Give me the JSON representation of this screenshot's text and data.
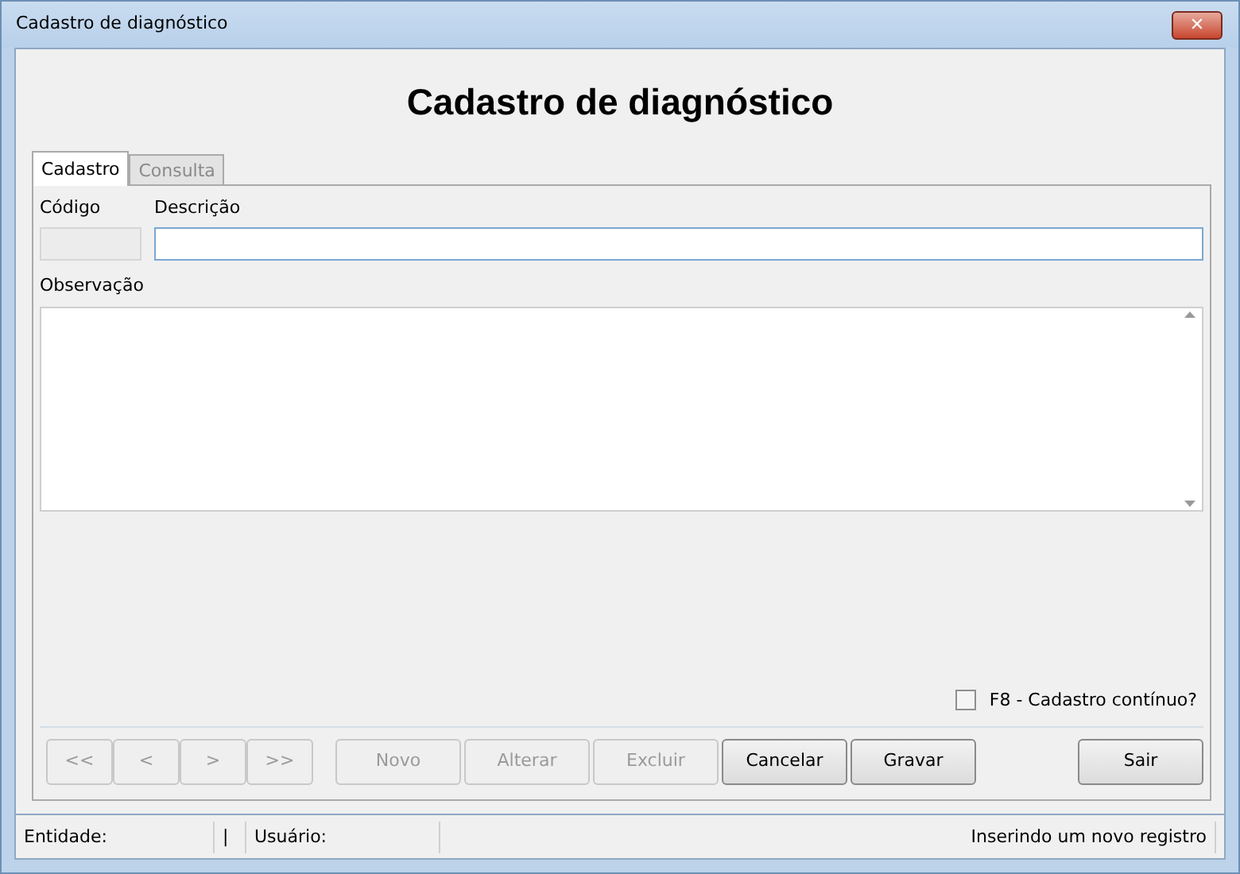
{
  "window": {
    "title": "Cadastro de diagnóstico",
    "close": "✕"
  },
  "heading": "Cadastro de diagnóstico",
  "tabs": [
    {
      "label": "Cadastro",
      "selected": true
    },
    {
      "label": "Consulta",
      "selected": false
    }
  ],
  "fields": {
    "codigo": {
      "label": "Código",
      "disabled": true
    },
    "descricao": {
      "label": "Descrição"
    },
    "observacao": {
      "label": "Observação"
    }
  },
  "continuous": {
    "label": "F8 - Cadastro contínuo?",
    "checked": false
  },
  "nav_buttons": [
    {
      "label": "<<",
      "disabled": true
    },
    {
      "label": "<",
      "disabled": true
    },
    {
      "label": ">",
      "disabled": true
    },
    {
      "label": ">>",
      "disabled": true
    }
  ],
  "action_buttons": [
    {
      "label": "Novo",
      "disabled": true
    },
    {
      "label": "Alterar",
      "disabled": true
    },
    {
      "label": "Excluir",
      "disabled": true
    },
    {
      "label": "Cancelar",
      "disabled": false
    },
    {
      "label": "Gravar",
      "disabled": false
    }
  ],
  "exit_button": {
    "label": "Sair",
    "disabled": false
  },
  "status_bar": [
    {
      "text": "Entidade:"
    },
    {
      "text": "|"
    },
    {
      "text": "Usuário:"
    },
    {
      "text": "Inserindo um novo registro"
    }
  ]
}
